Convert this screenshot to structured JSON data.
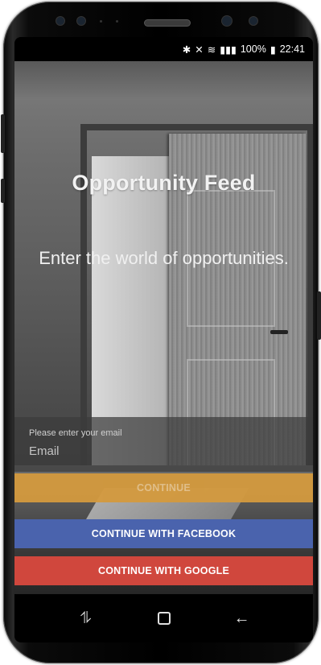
{
  "status_bar": {
    "icons": [
      "bluetooth-icon",
      "mute-icon",
      "wifi-icon",
      "signal-icon"
    ],
    "battery": "100%",
    "time": "22:41"
  },
  "hero": {
    "title": "Opportunity Feed",
    "subtitle": "Enter the world of opportunities."
  },
  "email": {
    "hint": "Please enter your email",
    "placeholder": "Email"
  },
  "buttons": {
    "continue": "CONTINUE",
    "facebook": "CONTINUE WITH FACEBOOK",
    "google": "CONTINUE WITH GOOGLE"
  },
  "colors": {
    "continue": "#d49a3e",
    "facebook": "#4a63ad",
    "google": "#d0473d"
  },
  "nav_bar": {
    "icons": [
      "recent-apps-icon",
      "home-icon",
      "back-icon"
    ]
  }
}
